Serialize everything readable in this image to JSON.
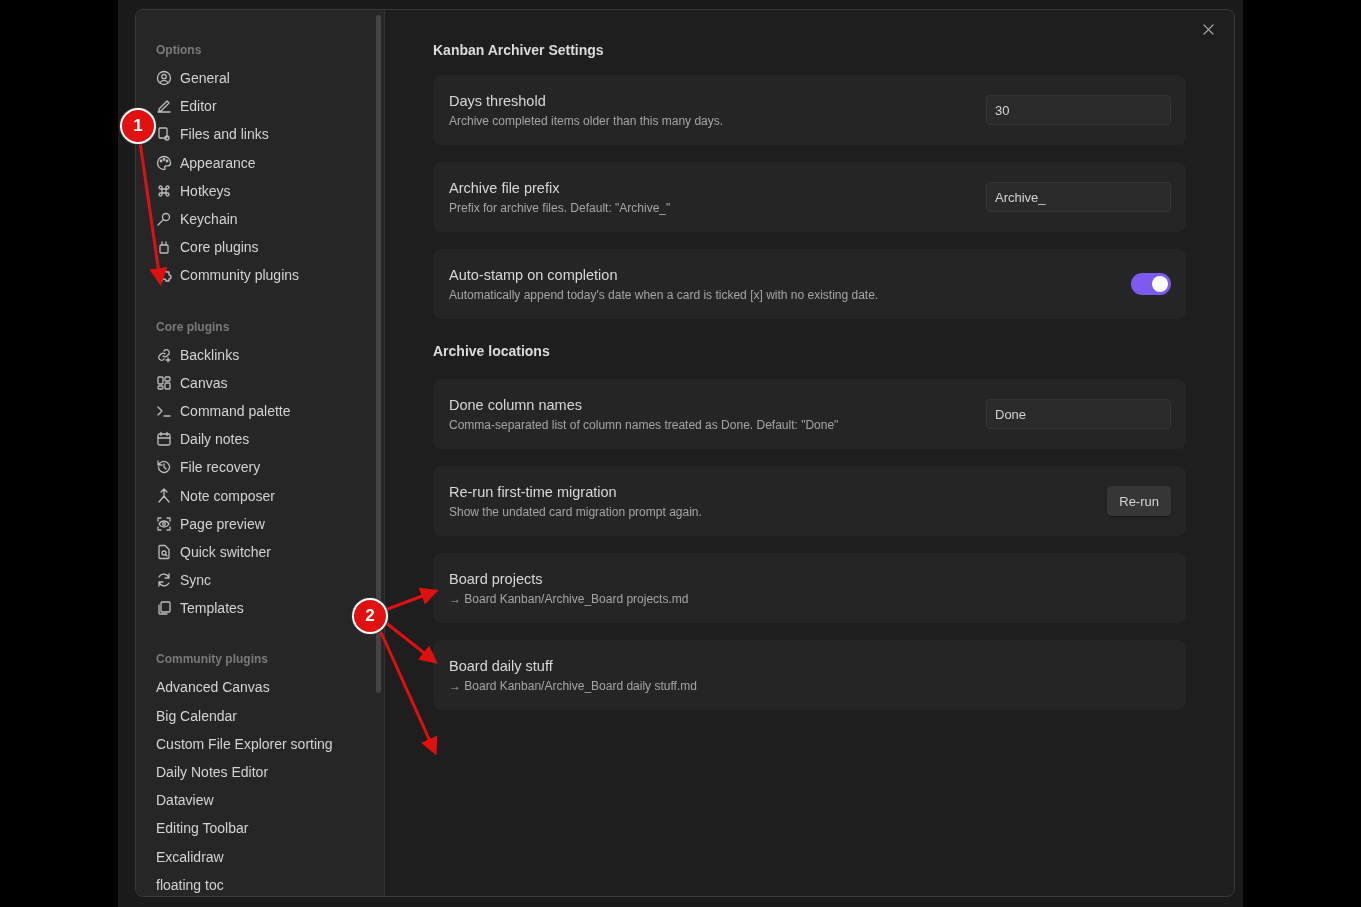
{
  "sidebar": {
    "sections": [
      {
        "heading": "Options",
        "kind": "icons",
        "items": [
          {
            "label": "General",
            "selected": false
          },
          {
            "label": "Editor",
            "selected": false
          },
          {
            "label": "Files and links",
            "selected": false
          },
          {
            "label": "Appearance",
            "selected": false
          },
          {
            "label": "Hotkeys",
            "selected": false
          },
          {
            "label": "Keychain",
            "selected": false
          },
          {
            "label": "Core plugins",
            "selected": false
          },
          {
            "label": "Community plugins",
            "selected": false
          }
        ]
      },
      {
        "heading": "Core plugins",
        "kind": "icons",
        "items": [
          {
            "label": "Backlinks",
            "selected": false
          },
          {
            "label": "Canvas",
            "selected": false
          },
          {
            "label": "Command palette",
            "selected": false
          },
          {
            "label": "Daily notes",
            "selected": false
          },
          {
            "label": "File recovery",
            "selected": false
          },
          {
            "label": "Note composer",
            "selected": false
          },
          {
            "label": "Page preview",
            "selected": false
          },
          {
            "label": "Quick switcher",
            "selected": false
          },
          {
            "label": "Sync",
            "selected": false
          },
          {
            "label": "Templates",
            "selected": false
          }
        ]
      },
      {
        "heading": "Community plugins",
        "kind": "plain",
        "items": [
          {
            "label": "Advanced Canvas",
            "selected": false
          },
          {
            "label": "Big Calendar",
            "selected": false
          },
          {
            "label": "Custom File Explorer sorting",
            "selected": false
          },
          {
            "label": "Daily Notes Editor",
            "selected": false
          },
          {
            "label": "Dataview",
            "selected": false
          },
          {
            "label": "Editing Toolbar",
            "selected": false
          },
          {
            "label": "Excalidraw",
            "selected": false
          },
          {
            "label": "floating toc",
            "selected": false
          }
        ]
      }
    ]
  },
  "settings": [
    {
      "kind": "heading",
      "text": "Kanban Archiver Settings"
    },
    {
      "kind": "text",
      "name": "Days threshold",
      "description": "Archive completed items older than this many days.",
      "value": "30"
    },
    {
      "kind": "text",
      "name": "Archive file prefix",
      "description": "Prefix for archive files. Default: \"Archive_\"",
      "value": "Archive_"
    },
    {
      "kind": "toggle",
      "name": "Auto-stamp on completion",
      "description": "Automatically append today's date when a card is ticked [x] with no existing date.",
      "on": true
    },
    {
      "kind": "heading",
      "text": "Archive locations"
    },
    {
      "kind": "text",
      "name": "Done column names",
      "description": "Comma-separated list of column names treated as Done. Default: \"Done\"",
      "value": "Done"
    },
    {
      "kind": "button",
      "name": "Re-run first-time migration",
      "description": "Show the undated card migration prompt again.",
      "button": "Re-run"
    },
    {
      "kind": "info",
      "name": "Board projects",
      "description": "→ Board Kanban/Archive_Board projects.md"
    },
    {
      "kind": "info",
      "name": "Board daily stuff",
      "description": "→ Board Kanban/Archive_Board daily stuff.md"
    }
  ],
  "callouts": [
    "1",
    "2"
  ]
}
